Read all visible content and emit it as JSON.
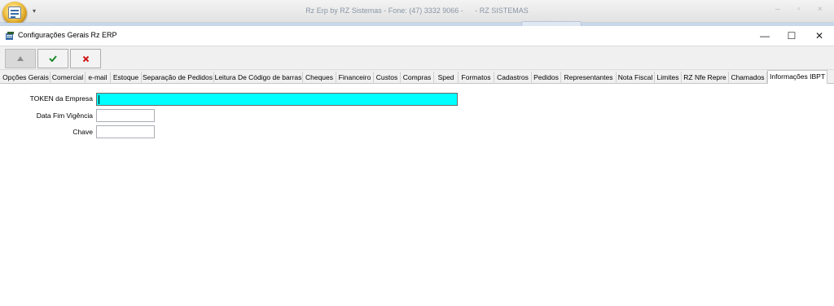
{
  "app": {
    "title_main": "Rz Erp by RZ Sistemas - Fone: (47) 3332 9066 -",
    "title_sub": "- RZ SISTEMAS",
    "controls": {
      "minimize": "–",
      "restore": "▫",
      "close": "×"
    }
  },
  "window": {
    "title": "Configurações Gerais Rz ERP",
    "controls": {
      "minimize": "—",
      "maximize": "☐",
      "close": "✕"
    }
  },
  "toolbar": {
    "buttons": [
      {
        "name": "up-button",
        "icon": "triangle-up-icon",
        "color": "#8c8c8c",
        "enabled": false
      },
      {
        "name": "confirm-button",
        "icon": "checkmark-icon",
        "color": "#1a8a2a",
        "enabled": true
      },
      {
        "name": "cancel-button",
        "icon": "x-icon",
        "color": "#d01818",
        "enabled": true
      }
    ]
  },
  "tabs": [
    "Opções Gerais",
    "Comercial",
    "e-mail",
    "Estoque",
    "Separação de Pedidos",
    "Leitura De Código de barras",
    "Cheques",
    "Financeiro",
    "Custos",
    "Compras",
    "Sped",
    "Formatos",
    "Cadastros",
    "Pedidos",
    "Representantes",
    "Nota Fiscal",
    "Limites",
    "RZ Nfe Repre",
    "Chamados",
    "Informações IBPT"
  ],
  "active_tab": "Informações IBPT",
  "form": {
    "token_label": "TOKEN da Empresa",
    "token_value": "",
    "data_fim_label": "Data Fim Vigência",
    "data_fim_value": "",
    "chave_label": "Chave",
    "chave_value": ""
  },
  "colors": {
    "focused_field": "#00ffff",
    "confirm": "#1a8a2a",
    "cancel": "#d01818"
  }
}
